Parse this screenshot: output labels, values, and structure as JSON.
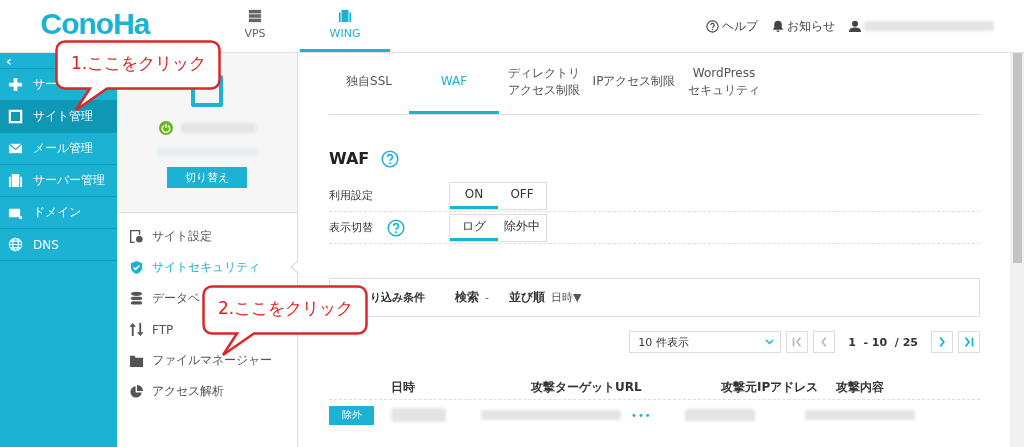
{
  "header": {
    "logo": "ConoHa",
    "nav": [
      {
        "label": "VPS",
        "selected": false
      },
      {
        "label": "WING",
        "selected": true
      }
    ],
    "help": "ヘルプ",
    "notice": "お知らせ"
  },
  "sidebar": {
    "collapse": "‹",
    "items": [
      {
        "label": "サー",
        "selected": false
      },
      {
        "label": "サイト管理",
        "selected": true
      },
      {
        "label": "メール管理",
        "selected": false
      },
      {
        "label": "サーバー管理",
        "selected": false
      },
      {
        "label": "ドメイン",
        "selected": false
      },
      {
        "label": "DNS",
        "selected": false
      }
    ]
  },
  "site_panel": {
    "switch_button": "切り替え",
    "menu": [
      {
        "label": "サイト設定",
        "selected": false
      },
      {
        "label": "サイトセキュリティ",
        "selected": true
      },
      {
        "label": "データベ",
        "selected": false
      },
      {
        "label": "FTP",
        "selected": false
      },
      {
        "label": "ファイルマネージャー",
        "selected": false
      },
      {
        "label": "アクセス解析",
        "selected": false
      }
    ]
  },
  "tabs": [
    {
      "label": "独自SSL",
      "selected": false
    },
    {
      "label": "WAF",
      "selected": true
    },
    {
      "label": "ディレクトリアクセス制限",
      "selected": false
    },
    {
      "label": "IPアクセス制限",
      "selected": false
    },
    {
      "label": "WordPress\nセキュリティ",
      "selected": false
    }
  ],
  "title": "WAF",
  "settings": [
    {
      "label": "利用設定",
      "help": false,
      "options": [
        {
          "label": "ON",
          "selected": true
        },
        {
          "label": "OFF",
          "selected": false
        }
      ]
    },
    {
      "label": "表示切替",
      "help": true,
      "options": [
        {
          "label": "ログ",
          "selected": true
        },
        {
          "label": "除外中",
          "selected": false
        }
      ]
    }
  ],
  "filter": {
    "title": "り込み条件",
    "search_label": "検索",
    "search_value": "-",
    "sort_label": "並び順",
    "sort_value": "日時▼"
  },
  "pager": {
    "per_page": "10 件表示",
    "range": "1  - 10  / 25",
    "buttons": [
      {
        "kind": "first",
        "disabled": true
      },
      {
        "kind": "prev",
        "disabled": true
      },
      {
        "kind": "next",
        "disabled": false
      },
      {
        "kind": "last",
        "disabled": false
      }
    ]
  },
  "table": {
    "columns": [
      "日時",
      "攻撃ターゲットURL",
      "攻撃元IPアドレス",
      "攻撃内容"
    ],
    "rows": [
      {
        "button": "除外",
        "more": "•••"
      }
    ]
  },
  "callouts": [
    {
      "text": "1.ここをクリック"
    },
    {
      "text": "2.ここをクリック"
    }
  ]
}
